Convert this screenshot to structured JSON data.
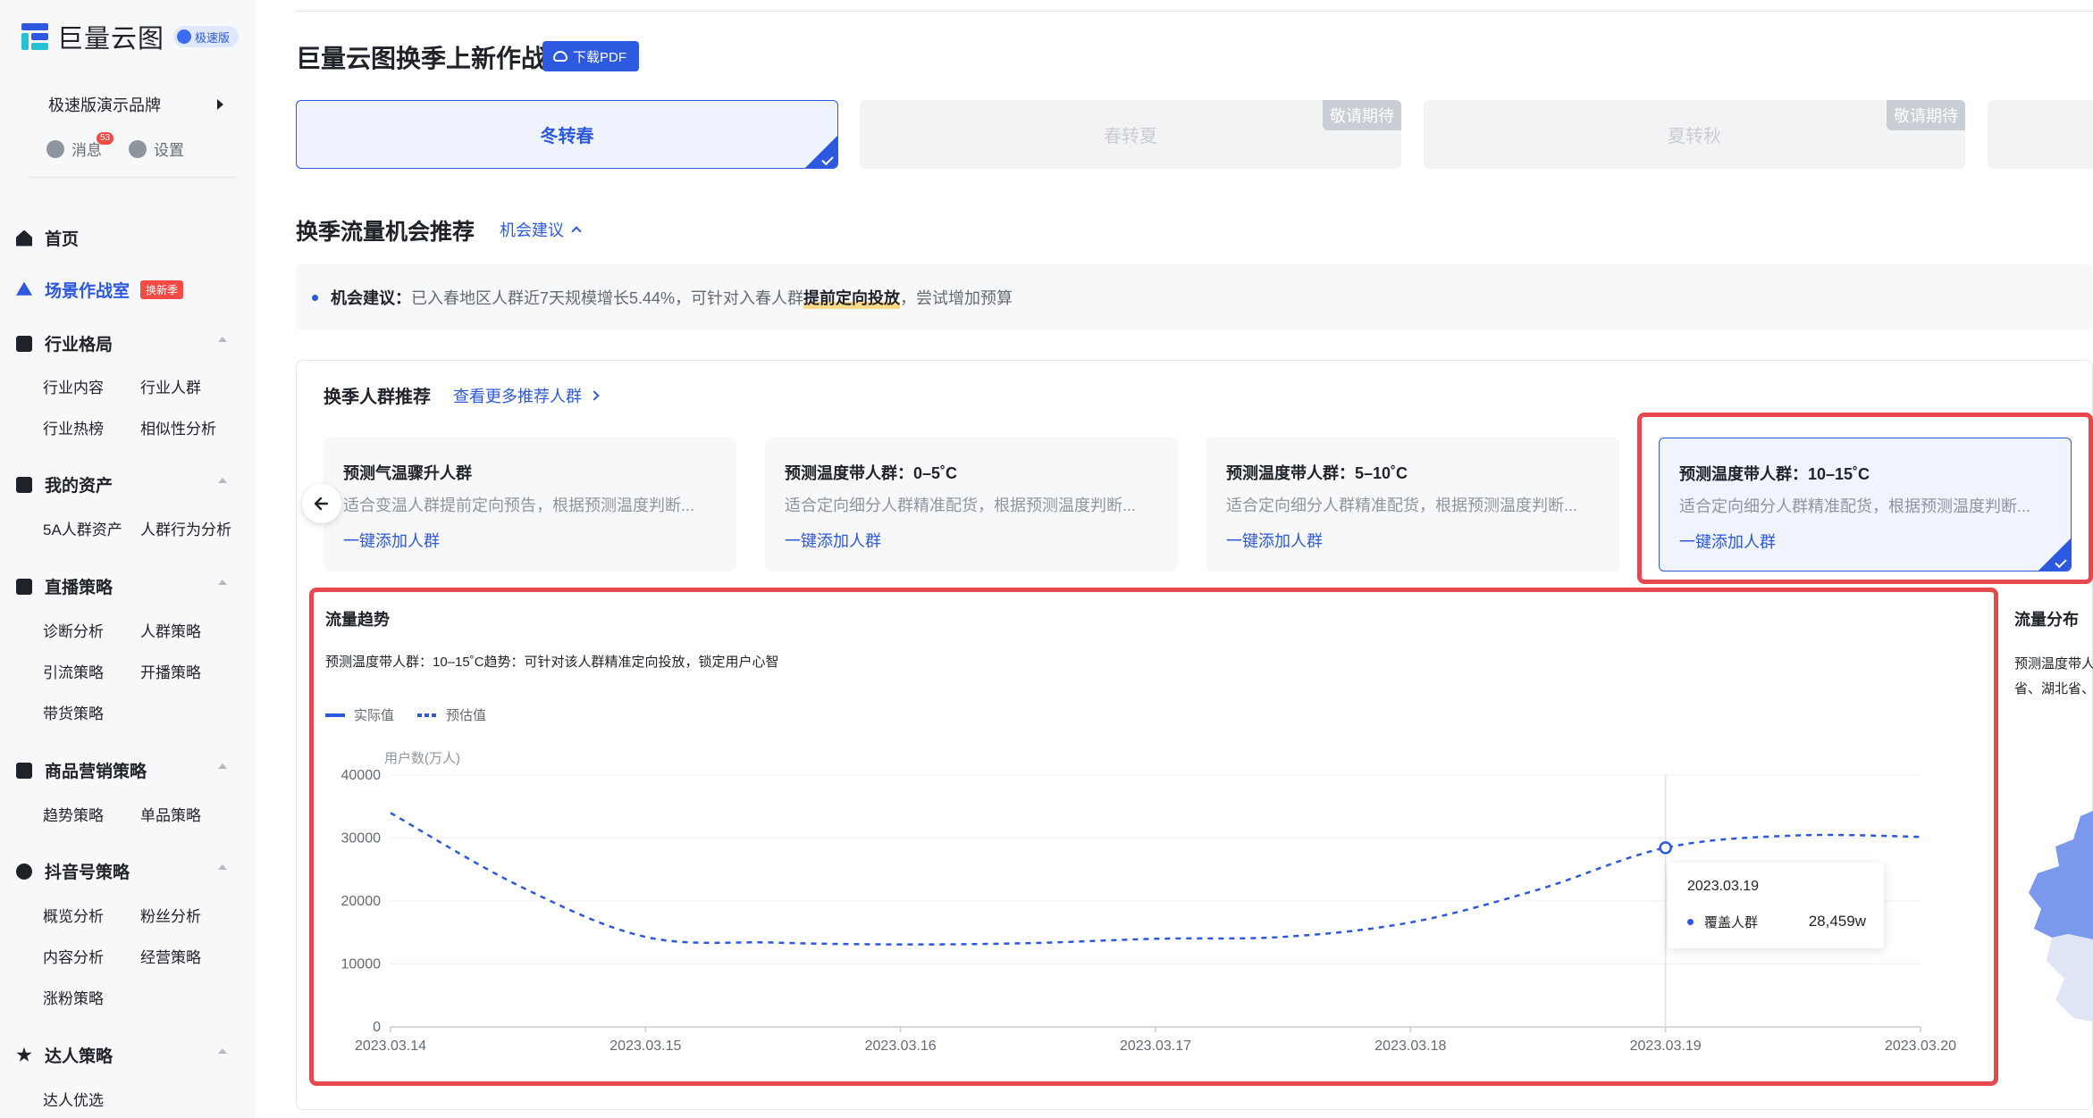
{
  "app": {
    "logo_text": "巨量云图",
    "logo_badge": "极速版",
    "brand": "极速版演示品牌",
    "messages_label": "消息",
    "messages_count": "53",
    "settings_label": "设置"
  },
  "colors": {
    "accent": "#2d58e0",
    "highlight_box": "#e5484d",
    "hot_tag": "#f54a45",
    "muted": "#c9cdd4"
  },
  "sidebar": {
    "home": "首页",
    "scene": "场景作战室",
    "scene_tag": "换新季",
    "groups": [
      {
        "label": "行业格局",
        "items": [
          "行业内容",
          "行业人群",
          "行业热榜",
          "相似性分析"
        ]
      },
      {
        "label": "我的资产",
        "items": [
          "5A人群资产",
          "人群行为分析"
        ]
      },
      {
        "label": "直播策略",
        "items": [
          "诊断分析",
          "人群策略",
          "引流策略",
          "开播策略",
          "带货策略"
        ]
      },
      {
        "label": "商品营销策略",
        "items": [
          "趋势策略",
          "单品策略"
        ]
      },
      {
        "label": "抖音号策略",
        "items": [
          "概览分析",
          "粉丝分析",
          "内容分析",
          "经营策略",
          "涨粉策略"
        ]
      },
      {
        "label": "达人策略",
        "items": [
          "达人优选"
        ]
      }
    ]
  },
  "header": {
    "title": "巨量云图换季上新作战",
    "pdf_button": "下载PDF"
  },
  "season_tabs": [
    {
      "label": "冬转春",
      "active": true
    },
    {
      "label": "春转夏",
      "badge": "敬请期待"
    },
    {
      "label": "夏转秋",
      "badge": "敬请期待"
    }
  ],
  "opportunity": {
    "title": "换季流量机会推荐",
    "link": "机会建议",
    "advice_label": "机会建议：",
    "advice_text_1": "已入春地区人群近7天规模增长5.44%，可针对入春人群",
    "advice_highlight": "提前定向投放",
    "advice_text_2": "，尝试增加预算"
  },
  "crowd": {
    "title": "换季人群推荐",
    "more_link": "查看更多推荐人群",
    "cards": [
      {
        "title": "预测气温骤升人群",
        "desc": "适合变温人群提前定向预告，根据预测温度判断...",
        "action": "一键添加人群"
      },
      {
        "title": "预测温度带人群：0–5˚C",
        "desc": "适合定向细分人群精准配货，根据预测温度判断...",
        "action": "一键添加人群"
      },
      {
        "title": "预测温度带人群：5–10˚C",
        "desc": "适合定向细分人群精准配货，根据预测温度判断...",
        "action": "一键添加人群"
      },
      {
        "title": "预测温度带人群：10–15˚C",
        "desc": "适合定向细分人群精准配货，根据预测温度判断...",
        "action": "一键添加人群",
        "active": true
      }
    ]
  },
  "trend": {
    "title": "流量趋势",
    "subtitle": "预测温度带人群：10–15˚C趋势：可针对该人群精准定向投放，锁定用户心智",
    "legend_actual": "实际值",
    "legend_forecast": "预估值",
    "tooltip": {
      "date": "2023.03.19",
      "name": "覆盖人群",
      "value": "28,459w"
    }
  },
  "distribution": {
    "title": "流量分布",
    "subtitle_line1": "预测温度带人",
    "subtitle_line2": "省、湖北省、"
  },
  "chart_data": {
    "type": "line",
    "ylabel": "用户数(万人)",
    "ylim": [
      0,
      40000
    ],
    "yticks": [
      "0",
      "10000",
      "20000",
      "30000",
      "40000"
    ],
    "x": [
      "2023.03.14",
      "2023.03.15",
      "2023.03.16",
      "2023.03.17",
      "2023.03.18",
      "2023.03.19",
      "2023.03.20"
    ],
    "grid": true,
    "legend": "top-left",
    "series": [
      {
        "name": "预估值",
        "style": "dashed",
        "x_fine": [
          0,
          0.5,
          1,
          1.5,
          2,
          2.5,
          3,
          3.5,
          4,
          4.5,
          5,
          5.5,
          6
        ],
        "values": [
          34000,
          22500,
          14300,
          13400,
          13100,
          13300,
          14000,
          14300,
          16600,
          21800,
          28459,
          30400,
          30200
        ]
      }
    ],
    "highlight_index": 10
  }
}
